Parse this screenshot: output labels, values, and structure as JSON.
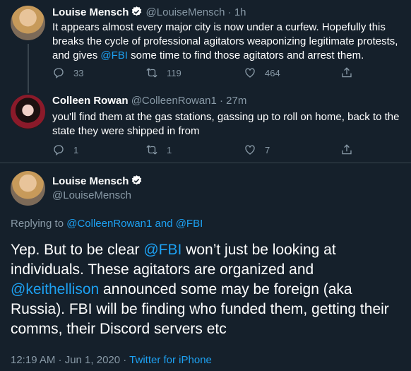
{
  "tweets": [
    {
      "name": "Louise Mensch",
      "handle": "@LouiseMensch",
      "time": "· 1h",
      "text_before": "It appears almost every major city is now under a curfew. Hopefully this breaks the cycle of professional agitators weaponizing legitimate protests, and gives ",
      "mention": "@FBI",
      "text_after": " some time to find those agitators and arrest them.",
      "replies": "33",
      "retweets": "119",
      "likes": "464"
    },
    {
      "name": "Colleen Rowan",
      "handle": "@ColleenRowan1",
      "time": "· 27m",
      "text": "you'll find them at the gas stations, gassing up to roll on home, back to the state they were shipped in from",
      "replies": "1",
      "retweets": "1",
      "likes": "7"
    }
  ],
  "main": {
    "name": "Louise Mensch",
    "handle": "@LouiseMensch",
    "replying_prefix": "Replying to ",
    "replying_to": "@ColleenRowan1 and @FBI",
    "text_1": "Yep. But to be clear ",
    "mention_1": "@FBI",
    "text_2": " won’t just be looking at individuals. These agitators are organized and ",
    "mention_2": "@keithellison",
    "text_3": " announced some may be foreign (aka Russia). FBI will be finding who funded them, getting their comms, their Discord servers etc",
    "timestamp": "12:19 AM · Jun 1, 2020 · ",
    "source": "Twitter for iPhone"
  },
  "colors": {
    "background": "#15202b",
    "accent": "#1da1f2",
    "muted": "#8899a6"
  },
  "icons": [
    "verified-badge-icon",
    "reply-icon",
    "retweet-icon",
    "like-icon",
    "share-icon"
  ]
}
